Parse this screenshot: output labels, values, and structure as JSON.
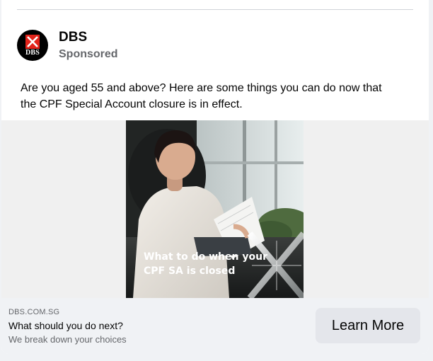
{
  "post": {
    "page_name": "DBS",
    "sponsored_label": "Sponsored",
    "avatar_text": "DBS",
    "body_line1": "Are you aged 55 and above? Here are some things you can do now that",
    "body_line2": "the CPF Special Account closure is in effect."
  },
  "creative": {
    "caption_line1": "What to do when your",
    "caption_line2": "CPF SA is closed"
  },
  "link_preview": {
    "domain": "DBS.COM.SG",
    "title": "What should you do next?",
    "description": "We break down your choices",
    "cta_label": "Learn More"
  },
  "colors": {
    "brand_red": "#e2231a",
    "card_bg": "#ffffff",
    "link_bar_bg": "#f0f2f5",
    "button_bg": "#e4e6eb"
  }
}
